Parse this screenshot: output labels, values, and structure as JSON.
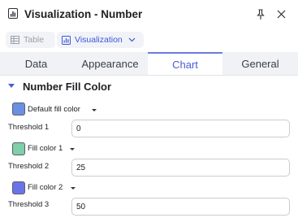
{
  "header": {
    "title": "Visualization - Number"
  },
  "chips": {
    "table_label": "Table",
    "visualization_label": "Visualization"
  },
  "tabs": [
    {
      "label": "Data",
      "active": false
    },
    {
      "label": "Appearance",
      "active": false
    },
    {
      "label": "Chart",
      "active": true
    },
    {
      "label": "General",
      "active": false
    }
  ],
  "section": {
    "title": "Number Fill Color"
  },
  "fills": [
    {
      "label": "Default fill color",
      "color": "#6b8fe3"
    },
    {
      "label": "Fill color 1",
      "color": "#7fcfa8"
    },
    {
      "label": "Fill color 2",
      "color": "#6b73e8"
    }
  ],
  "thresholds": [
    {
      "label": "Threshold 1",
      "value": "0"
    },
    {
      "label": "Threshold 2",
      "value": "25"
    },
    {
      "label": "Threshold 3",
      "value": "50"
    }
  ],
  "colors": {
    "accent": "#4a5bd8",
    "tab_bar": "#f0f2f5"
  }
}
